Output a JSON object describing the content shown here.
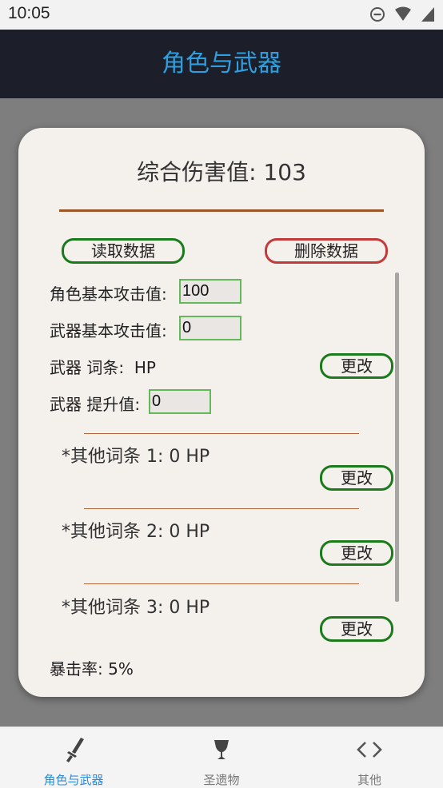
{
  "status_bar": {
    "time": "10:05",
    "icons": [
      "do-not-disturb-icon",
      "wifi-icon",
      "signal-icon"
    ]
  },
  "app_bar": {
    "title": "角色与武器"
  },
  "card": {
    "total_damage": "综合伤害值: 103",
    "read_button": "读取数据",
    "delete_button": "删除数据",
    "char_base_atk_label": "角色基本攻击值:",
    "char_base_atk_value": "100",
    "weapon_base_atk_label": "武器基本攻击值:",
    "weapon_base_atk_value": "0",
    "weapon_stat_label": "武器 词条:",
    "weapon_stat_value": "HP",
    "change_label": "更改",
    "weapon_refine_label": "武器 提升值:",
    "weapon_refine_value": "0",
    "other_stats": [
      {
        "text": "*其他词条 1: 0 HP"
      },
      {
        "text": "*其他词条 2: 0 HP"
      },
      {
        "text": "*其他词条 3: 0 HP"
      }
    ],
    "crit_rate": "暴击率: 5%"
  },
  "bottom_nav": {
    "items": [
      {
        "label": "角色与武器",
        "icon": "sword-icon",
        "active": true
      },
      {
        "label": "圣遗物",
        "icon": "goblet-icon",
        "active": false
      },
      {
        "label": "其他",
        "icon": "code-brackets-icon",
        "active": false
      }
    ]
  },
  "colors": {
    "app_bar_bg": "#1c1f29",
    "title_accent": "#2d9fe0",
    "green_border": "#1b7a1b",
    "red_border": "#c33a3a",
    "separator": "#9a5626",
    "nav_active": "#2d8ad8"
  }
}
